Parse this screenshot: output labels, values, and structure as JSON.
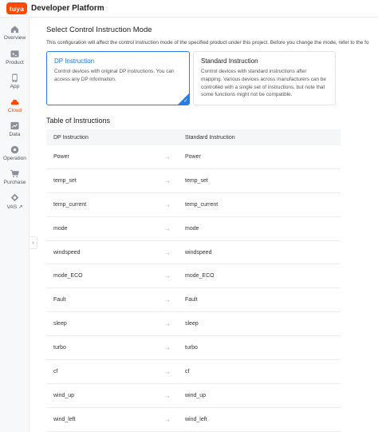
{
  "header": {
    "logo_text": "tuya",
    "title": "Developer Platform"
  },
  "sidebar": {
    "items": [
      {
        "label": "Overview",
        "icon": "home-icon"
      },
      {
        "label": "Product",
        "icon": "terminal-icon"
      },
      {
        "label": "App",
        "icon": "phone-icon"
      },
      {
        "label": "Cloud",
        "icon": "cloud-icon",
        "active": true
      },
      {
        "label": "Data",
        "icon": "chart-icon"
      },
      {
        "label": "Operation",
        "icon": "operation-icon"
      },
      {
        "label": "Purchase",
        "icon": "cart-icon"
      },
      {
        "label": "VAS ↗",
        "icon": "vas-icon"
      }
    ],
    "collapse_glyph": "›"
  },
  "main": {
    "section_title": "Select Control Instruction Mode",
    "notice": "This configuration will affect the control instruction mode of the specified product under this project. Before you change the mode, refer to the fo",
    "modes": [
      {
        "title": "DP Instruction",
        "description": "Control devices with original DP instructions. You can access any DP information.",
        "selected": true
      },
      {
        "title": "Standard Instruction",
        "description": "Control devices with standard instructions after mapping. Various devices across manufacturers can be controlled with a single set of instructions, but note that some functions might not be compatible.",
        "selected": false
      }
    ],
    "table_title": "Table of Instructions",
    "table": {
      "headers": [
        "DP Instruction",
        "Standard Instruction"
      ],
      "arrow": "→",
      "rows": [
        [
          "Power",
          "Power"
        ],
        [
          "temp_set",
          "temp_set"
        ],
        [
          "temp_current",
          "temp_current"
        ],
        [
          "mode",
          "mode"
        ],
        [
          "windspeed",
          "windspeed"
        ],
        [
          "mode_ECO",
          "mode_ECO"
        ],
        [
          "Fault",
          "Fault"
        ],
        [
          "sleep",
          "sleep"
        ],
        [
          "turbo",
          "turbo"
        ],
        [
          "cf",
          "cf"
        ],
        [
          "wind_up",
          "wind_up"
        ],
        [
          "wind_left",
          "wind_left"
        ]
      ]
    }
  },
  "colors": {
    "brand": "#ff4800",
    "accent": "#2a7bea",
    "sidebar_bg": "#f7f8fa",
    "table_header_bg": "#f5f6f8"
  }
}
